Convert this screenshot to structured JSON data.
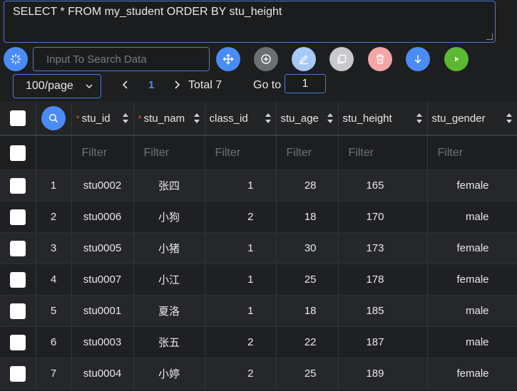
{
  "query": {
    "sql": "SELECT * FROM my_student ORDER BY stu_height"
  },
  "toolbar": {
    "search_placeholder": "Input To Search Data",
    "colors": {
      "refresh": "#4a8cf5",
      "move": "#4a8cf5",
      "add": "#6b6e73",
      "edit": "#a8c8f5",
      "copy": "#c8c9cc",
      "delete": "#f4a6a6",
      "export": "#4a8cf5",
      "run": "#5ab832"
    }
  },
  "pager": {
    "page_size": "100/page",
    "current_page": "1",
    "total": "Total 7",
    "goto_label": "Go to",
    "goto_value": "1"
  },
  "table": {
    "columns": [
      {
        "key": "stu_id",
        "label": "stu_id",
        "required": true
      },
      {
        "key": "stu_name",
        "label": "stu_nam",
        "required": true
      },
      {
        "key": "class_id",
        "label": "class_id",
        "required": false
      },
      {
        "key": "stu_age",
        "label": "stu_age",
        "required": false
      },
      {
        "key": "stu_height",
        "label": "stu_height",
        "required": false
      },
      {
        "key": "stu_gender",
        "label": "stu_gender",
        "required": false
      }
    ],
    "filter_placeholder": "Filter",
    "rows": [
      {
        "index": "1",
        "stu_id": "stu0002",
        "stu_name": "张四",
        "class_id": "1",
        "stu_age": "28",
        "stu_height": "165",
        "stu_gender": "female"
      },
      {
        "index": "2",
        "stu_id": "stu0006",
        "stu_name": "小狗",
        "class_id": "2",
        "stu_age": "18",
        "stu_height": "170",
        "stu_gender": "male"
      },
      {
        "index": "3",
        "stu_id": "stu0005",
        "stu_name": "小猪",
        "class_id": "1",
        "stu_age": "30",
        "stu_height": "173",
        "stu_gender": "female"
      },
      {
        "index": "4",
        "stu_id": "stu0007",
        "stu_name": "小江",
        "class_id": "1",
        "stu_age": "25",
        "stu_height": "178",
        "stu_gender": "female"
      },
      {
        "index": "5",
        "stu_id": "stu0001",
        "stu_name": "夏洛",
        "class_id": "1",
        "stu_age": "18",
        "stu_height": "185",
        "stu_gender": "male"
      },
      {
        "index": "6",
        "stu_id": "stu0003",
        "stu_name": "张五",
        "class_id": "2",
        "stu_age": "22",
        "stu_height": "187",
        "stu_gender": "male"
      },
      {
        "index": "7",
        "stu_id": "stu0004",
        "stu_name": "小婷",
        "class_id": "2",
        "stu_age": "25",
        "stu_height": "189",
        "stu_gender": "female"
      }
    ]
  }
}
